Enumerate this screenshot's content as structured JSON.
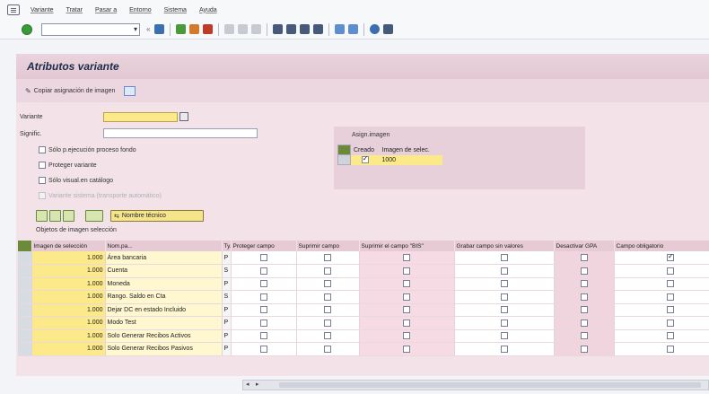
{
  "menu": [
    "Variante",
    "Tratar",
    "Pasar a",
    "Entorno",
    "Sistema",
    "Ayuda"
  ],
  "title": "Atributos variante",
  "appbar": {
    "copy_label": "Copiar asignación de imagen"
  },
  "fields": {
    "variante_label": "Variante",
    "signific_label": "Signific."
  },
  "options": [
    {
      "label": "Sólo p.ejecución proceso fondo",
      "checked": false,
      "disabled": false
    },
    {
      "label": "Proteger variante",
      "checked": false,
      "disabled": false
    },
    {
      "label": "Sólo visual.en catálogo",
      "checked": false,
      "disabled": false
    },
    {
      "label": "Variante sistema (transporte automático)",
      "checked": false,
      "disabled": true
    }
  ],
  "image_group": {
    "title": "Asign.imagen",
    "col_created": "Creado",
    "col_images": "Imagen de selec.",
    "row_value": "1000",
    "created_checked": true
  },
  "lower_toolbar": {
    "tech_name_label": "Nombre técnico"
  },
  "section_label": "Objetos de imagen selección",
  "table": {
    "headers": [
      "Imagen de selección",
      "Nom.pa...",
      "Ty.",
      "Proteger campo",
      "Suprimir campo",
      "Suprimir el campo \"BIS\"",
      "Grabar campo sin valores",
      "Desactivar GPA",
      "Campo obligatorio"
    ],
    "rows": [
      {
        "num": "1.000",
        "name": "Área bancaria",
        "type": "P",
        "last_checked": true
      },
      {
        "num": "1.000",
        "name": "Cuenta",
        "type": "S",
        "last_checked": false
      },
      {
        "num": "1.000",
        "name": "Moneda",
        "type": "P",
        "last_checked": false
      },
      {
        "num": "1.000",
        "name": "Rango. Saldo en Cta",
        "type": "S",
        "last_checked": false
      },
      {
        "num": "1.000",
        "name": "Dejar DC en estado Incluido",
        "type": "P",
        "last_checked": false
      },
      {
        "num": "1.000",
        "name": "Modo Test",
        "type": "P",
        "last_checked": false
      },
      {
        "num": "1.000",
        "name": "Solo Generar Recibos Activos",
        "type": "P",
        "last_checked": false
      },
      {
        "num": "1.000",
        "name": "Solo Generar Recibos Pasivos",
        "type": "P",
        "last_checked": false
      }
    ]
  }
}
